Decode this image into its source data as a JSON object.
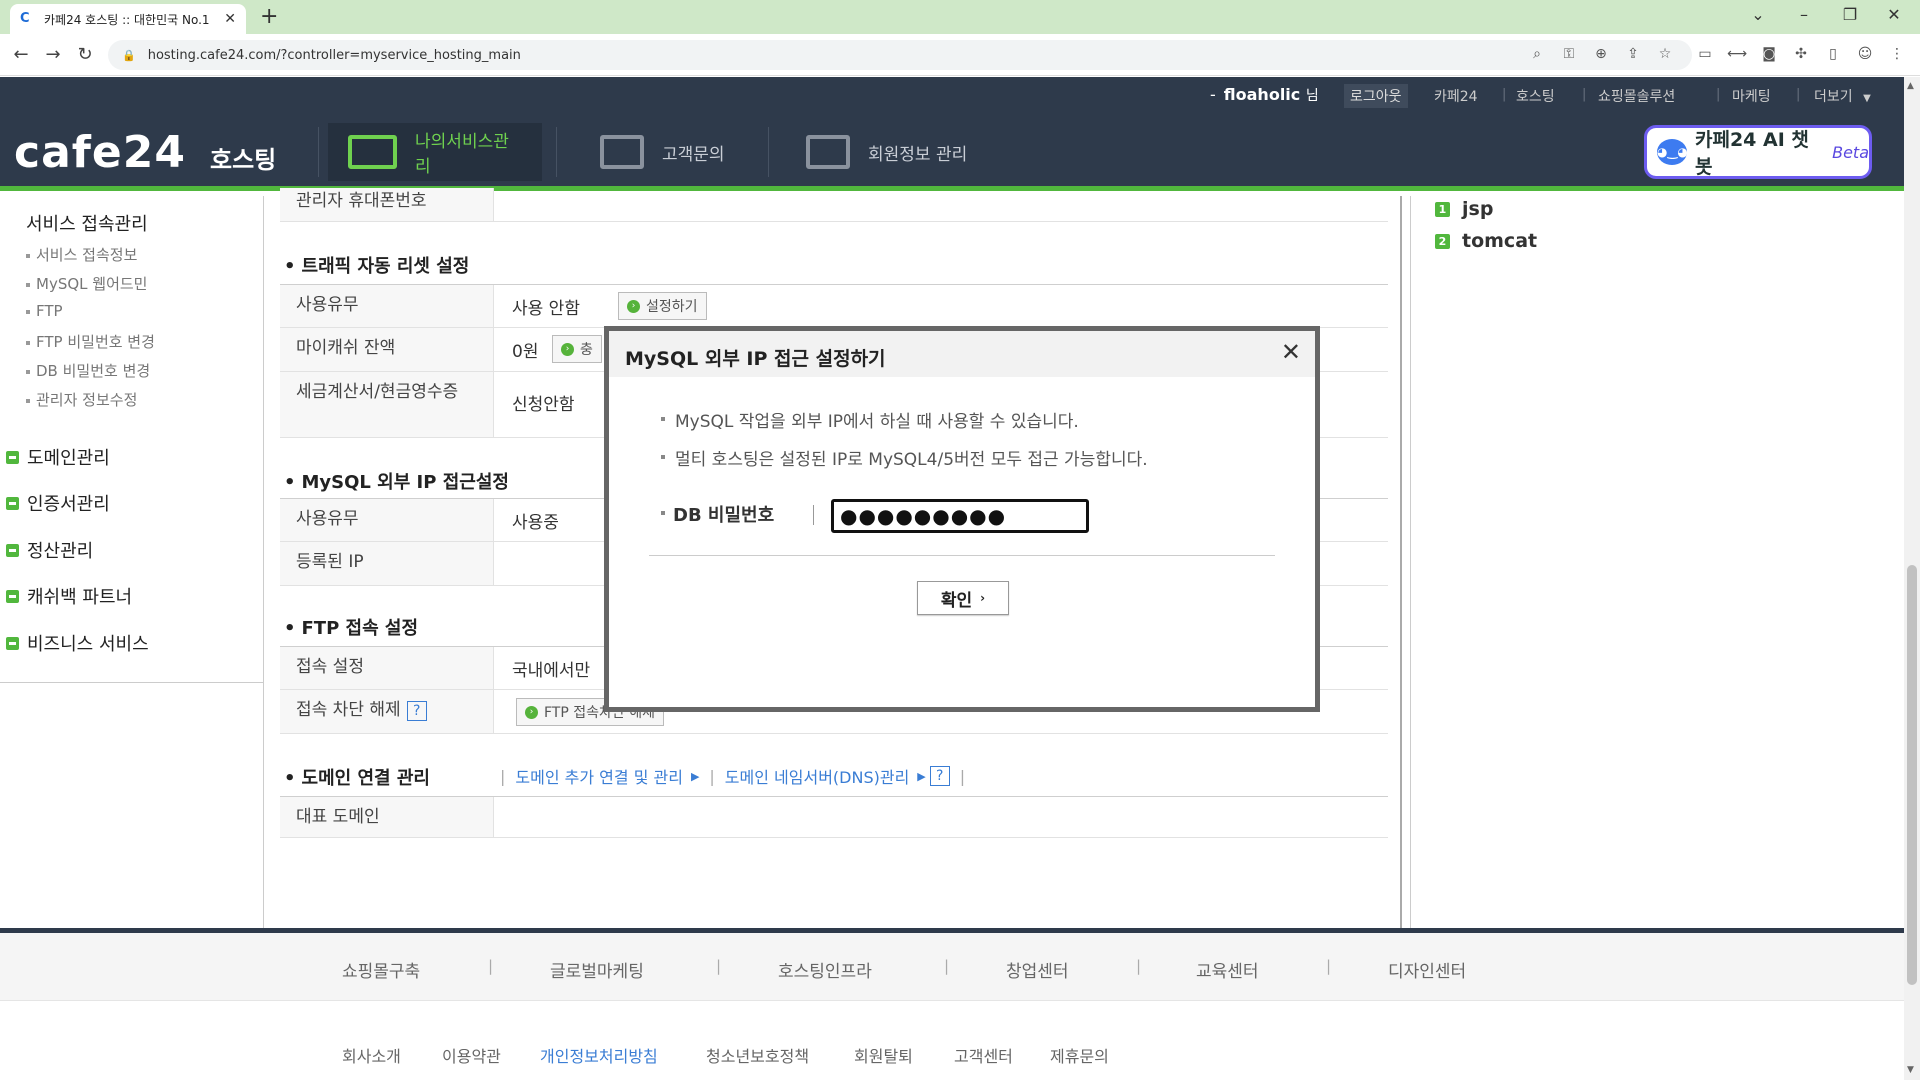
{
  "browser": {
    "tab_title": "카페24 호스팅 :: 대한민국 No.1",
    "favicon": "C",
    "url": "hosting.cafe24.com/?controller=myservice_hosting_main"
  },
  "header": {
    "user_name": "floaholic",
    "user_suffix": "님",
    "logout": "로그아웃",
    "top_links": [
      "카페24",
      "호스팅",
      "쇼핑몰솔루션",
      "마케팅",
      "더보기"
    ],
    "logo": "cafe24",
    "logo_sub": "호스팅",
    "gnb": [
      "나의서비스관리",
      "고객문의",
      "회원정보 관리"
    ],
    "chatbot": "카페24 AI 챗봇",
    "chatbot_beta": "Beta"
  },
  "sidebar": {
    "section_title": "서비스 접속관리",
    "sub_items": [
      "서비스 접속정보",
      "MySQL 웹어드민",
      "FTP",
      "FTP 비밀번호 변경",
      "DB 비밀번호 변경",
      "관리자 정보수정"
    ],
    "menus": [
      "도메인관리",
      "인증서관리",
      "정산관리",
      "캐쉬백 파트너",
      "비즈니스 서비스"
    ]
  },
  "content": {
    "row_phone": "관리자 휴대폰번호",
    "traffic_title": "트래픽 자동 리셋 설정",
    "traffic_rows": [
      {
        "label": "사용유무",
        "value": "사용 안함",
        "button": "설정하기"
      },
      {
        "label": "마이캐쉬 잔액",
        "value": "0원",
        "button": "충"
      },
      {
        "label": "세금계산서/현금영수증",
        "value": "신청안함"
      }
    ],
    "mysql_title": "MySQL 외부 IP 접근설정",
    "mysql_rows": [
      {
        "label": "사용유무",
        "value": "사용중"
      },
      {
        "label": "등록된 IP",
        "value": ""
      }
    ],
    "ftp_title": "FTP 접속 설정",
    "ftp_rows": [
      {
        "label": "접속 설정",
        "value": "국내에서만"
      },
      {
        "label": "접속 차단 해제",
        "button": "FTP 접속차단 해제"
      }
    ],
    "domain_title": "도메인 연결 관리",
    "domain_links": [
      "도메인 추가 연결 및 관리",
      "도메인 네임서버(DNS)관리"
    ],
    "domain_row": "대표 도메인",
    "help": "?"
  },
  "right_panel": {
    "items": [
      {
        "num": "1",
        "label": "jsp"
      },
      {
        "num": "2",
        "label": "tomcat"
      }
    ]
  },
  "footer": {
    "links1": [
      "쇼핑몰구축",
      "글로벌마케팅",
      "호스팅인프라",
      "창업센터",
      "교육센터",
      "디자인센터"
    ],
    "links2": [
      "회사소개",
      "이용약관",
      "개인정보처리방침",
      "청소년보호정책",
      "회원탈퇴",
      "고객센터",
      "제휴문의"
    ]
  },
  "modal": {
    "title": "MySQL 외부 IP 접근 설정하기",
    "notes": [
      "MySQL 작업을 외부 IP에서 하실 때 사용할 수 있습니다.",
      "멀티 호스팅은 설정된 IP로 MySQL4/5버전 모두 접근 가능합니다."
    ],
    "field_label": "DB 비밀번호",
    "password_value": "●●●●●●●●●",
    "ok_label": "확인"
  },
  "colors": {
    "header_bg": "#2e3a4b",
    "accent_green": "#51b73d",
    "link_blue": "#3a7dd4"
  }
}
